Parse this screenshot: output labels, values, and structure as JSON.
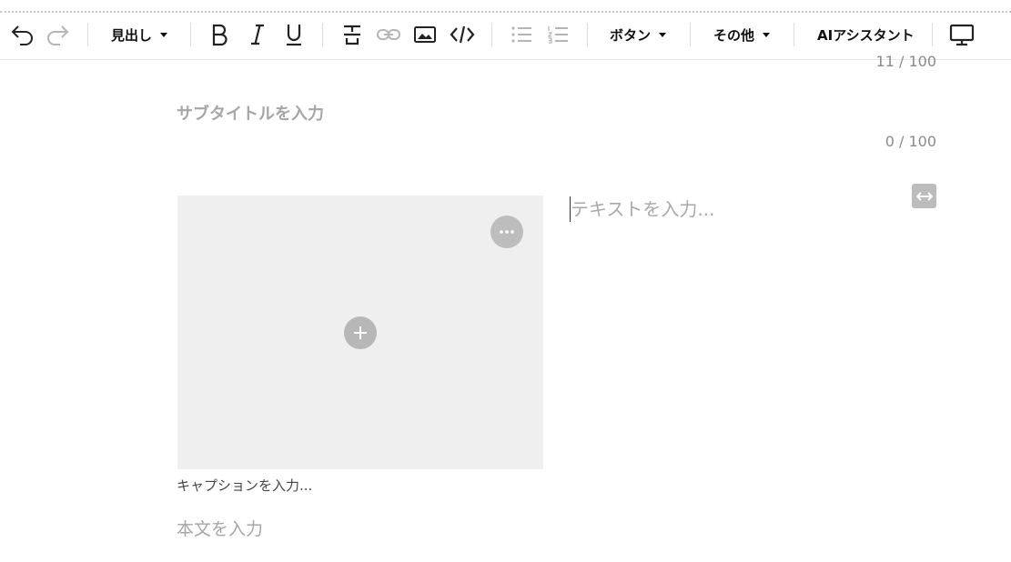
{
  "toolbar": {
    "heading_label": "見出し",
    "button_label": "ボタン",
    "other_label": "その他",
    "ai_label": "AIアシスタント"
  },
  "title": {
    "counter": "11 / 100"
  },
  "subtitle": {
    "placeholder": "サブタイトルを入力",
    "counter": "0 / 100"
  },
  "image_block": {
    "caption_placeholder": "キャプションを入力..."
  },
  "text_block": {
    "placeholder": "テキストを入力..."
  },
  "body": {
    "placeholder": "本文を入力"
  },
  "colors": {
    "icon_active": "#222222",
    "icon_disabled": "#b5b5b5",
    "placeholder": "#a6a6a6",
    "image_bg": "#efefef"
  }
}
